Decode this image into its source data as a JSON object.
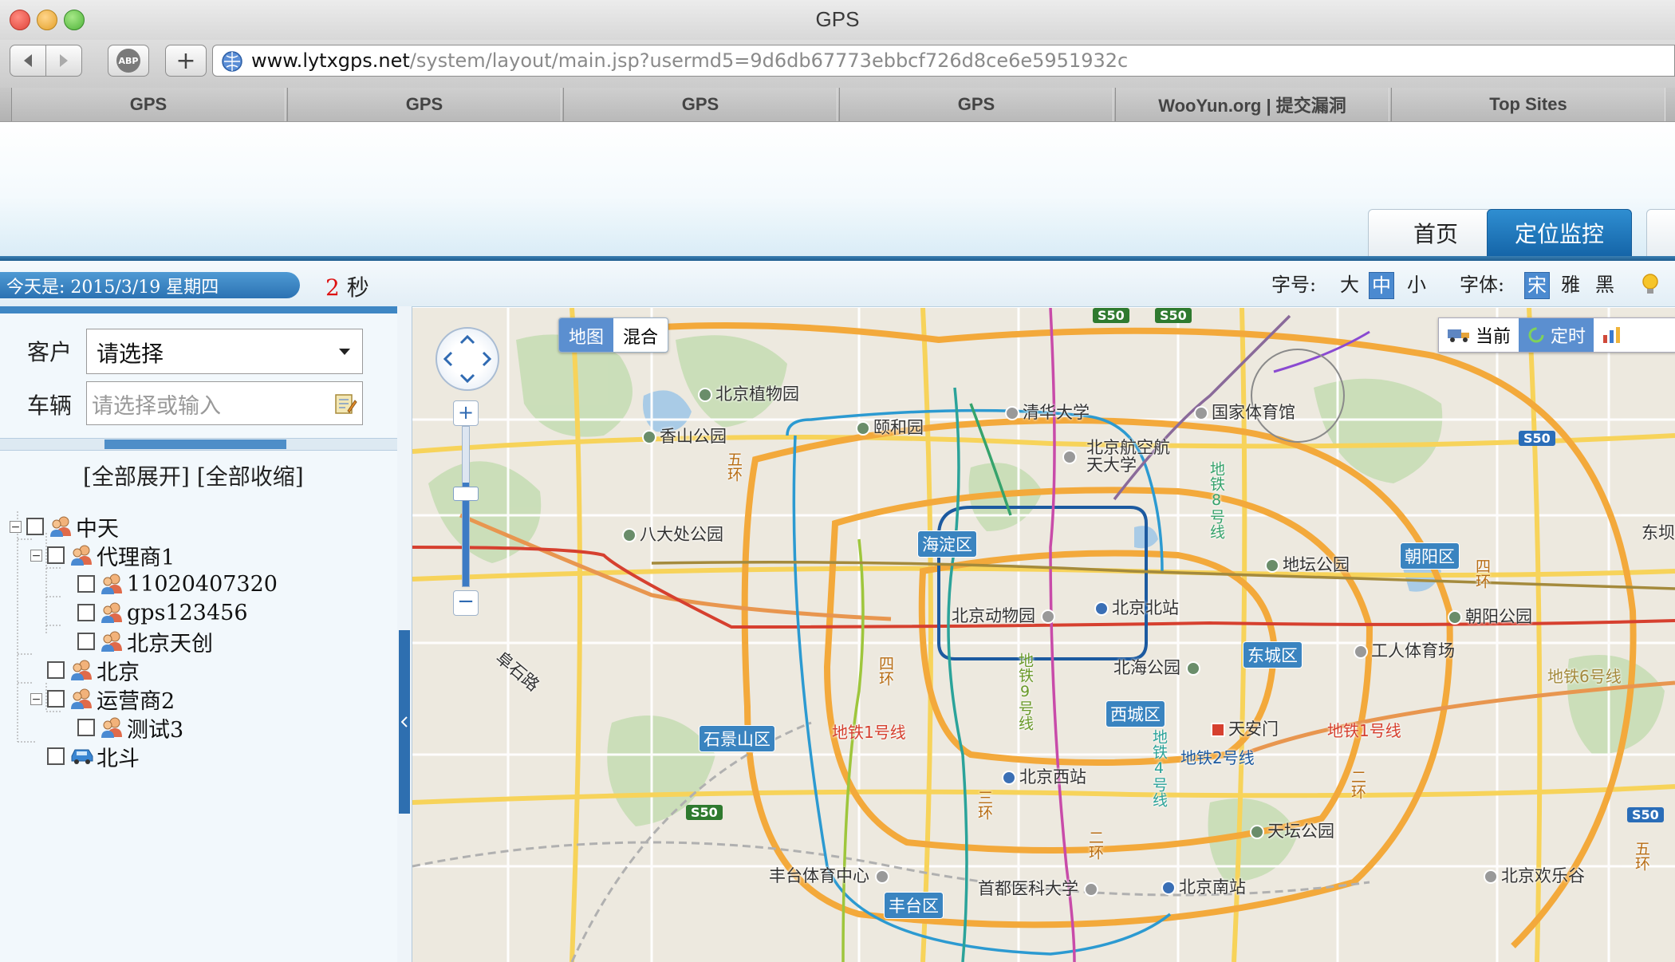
{
  "window": {
    "title": "GPS"
  },
  "browser": {
    "url_host": "www.lytxgps.net",
    "url_path": "/system/layout/main.jsp?usermd5=9d6db67773ebbcf726d8ce6e5951932c",
    "back_icon": "back-arrow-icon",
    "forward_icon": "forward-arrow-icon",
    "adblock_label": "ABP",
    "new_tab_glyph": "+",
    "tabs": [
      "GPS",
      "GPS",
      "GPS",
      "GPS",
      "WooYun.org | 提交漏洞",
      "Top Sites"
    ]
  },
  "nav": {
    "home": "首页",
    "monitor": "定位监控",
    "active": "定位监控"
  },
  "infobar": {
    "date": "今天是: 2015/3/19 星期四",
    "seconds_num": "2",
    "seconds_unit": "秒",
    "font_size_label": "字号:",
    "font_size_options": [
      "大",
      "中",
      "小"
    ],
    "font_size_selected": "中",
    "font_family_label": "字体:",
    "font_family_options": [
      "宋",
      "雅",
      "黑"
    ],
    "font_family_selected": "宋"
  },
  "filters": {
    "client_label": "客户",
    "client_value": "请选择",
    "vehicle_label": "车辆",
    "vehicle_placeholder": "请选择或输入"
  },
  "tree": {
    "expand_all": "[全部展开]",
    "collapse_all": "[全部收缩]",
    "nodes": [
      {
        "label": "中天",
        "level": 0,
        "toggle": "−",
        "icon": "user-group-icon"
      },
      {
        "label": "代理商1",
        "level": 1,
        "toggle": "−",
        "icon": "user-group-icon"
      },
      {
        "label": "11020407320",
        "level": 2,
        "toggle": "",
        "icon": "user-group-icon"
      },
      {
        "label": "gps123456",
        "level": 2,
        "toggle": "",
        "icon": "user-group-icon"
      },
      {
        "label": "北京天创",
        "level": 2,
        "toggle": "",
        "icon": "user-group-icon"
      },
      {
        "label": "北京",
        "level": 1,
        "toggle": "",
        "icon": "user-group-icon"
      },
      {
        "label": "运营商2",
        "level": 1,
        "toggle": "−",
        "icon": "user-group-icon"
      },
      {
        "label": "测试3",
        "level": 2,
        "toggle": "",
        "icon": "user-group-icon"
      },
      {
        "label": "北斗",
        "level": 1,
        "toggle": "",
        "icon": "car-icon"
      }
    ]
  },
  "map": {
    "type_options": [
      "地图",
      "混合"
    ],
    "type_selected": "地图",
    "tools": [
      "当前",
      "定时"
    ],
    "tool_selected": "定时",
    "districts": [
      "海淀区",
      "朝阳区",
      "东城区",
      "西城区",
      "石景山区",
      "丰台区"
    ],
    "places": [
      "北京植物园",
      "香山公园",
      "颐和园",
      "清华大学",
      "国家体育馆",
      "北京航空航天大学",
      "八大处公园",
      "地坛公园",
      "北京北站",
      "北京动物园",
      "朝阳公园",
      "工人体育场",
      "北海公园",
      "天安门",
      "北京西站",
      "天坛公园",
      "丰台体育中心",
      "首都医科大学",
      "北京南站",
      "北京欢乐谷",
      "阜石路",
      "东坝"
    ],
    "lines": [
      "地铁1号线",
      "地铁2号线",
      "地铁4号线",
      "地铁6号线",
      "地铁8号线",
      "地铁9号线"
    ],
    "rings": [
      "二环",
      "三环",
      "四环",
      "五环"
    ],
    "shields": [
      "S50"
    ],
    "colors": {
      "line1": "#d6402f",
      "line2": "#1c5aa0",
      "line4": "#2ba39a",
      "line6": "#a48a3c",
      "line8": "#36a36c",
      "line9": "#9ec63c",
      "line10": "#2c9ad1",
      "line5": "#c84ba9"
    }
  },
  "colors": {
    "accent": "#2b72b3",
    "nav_active": "#1565a8",
    "seconds": "#dd1111"
  }
}
